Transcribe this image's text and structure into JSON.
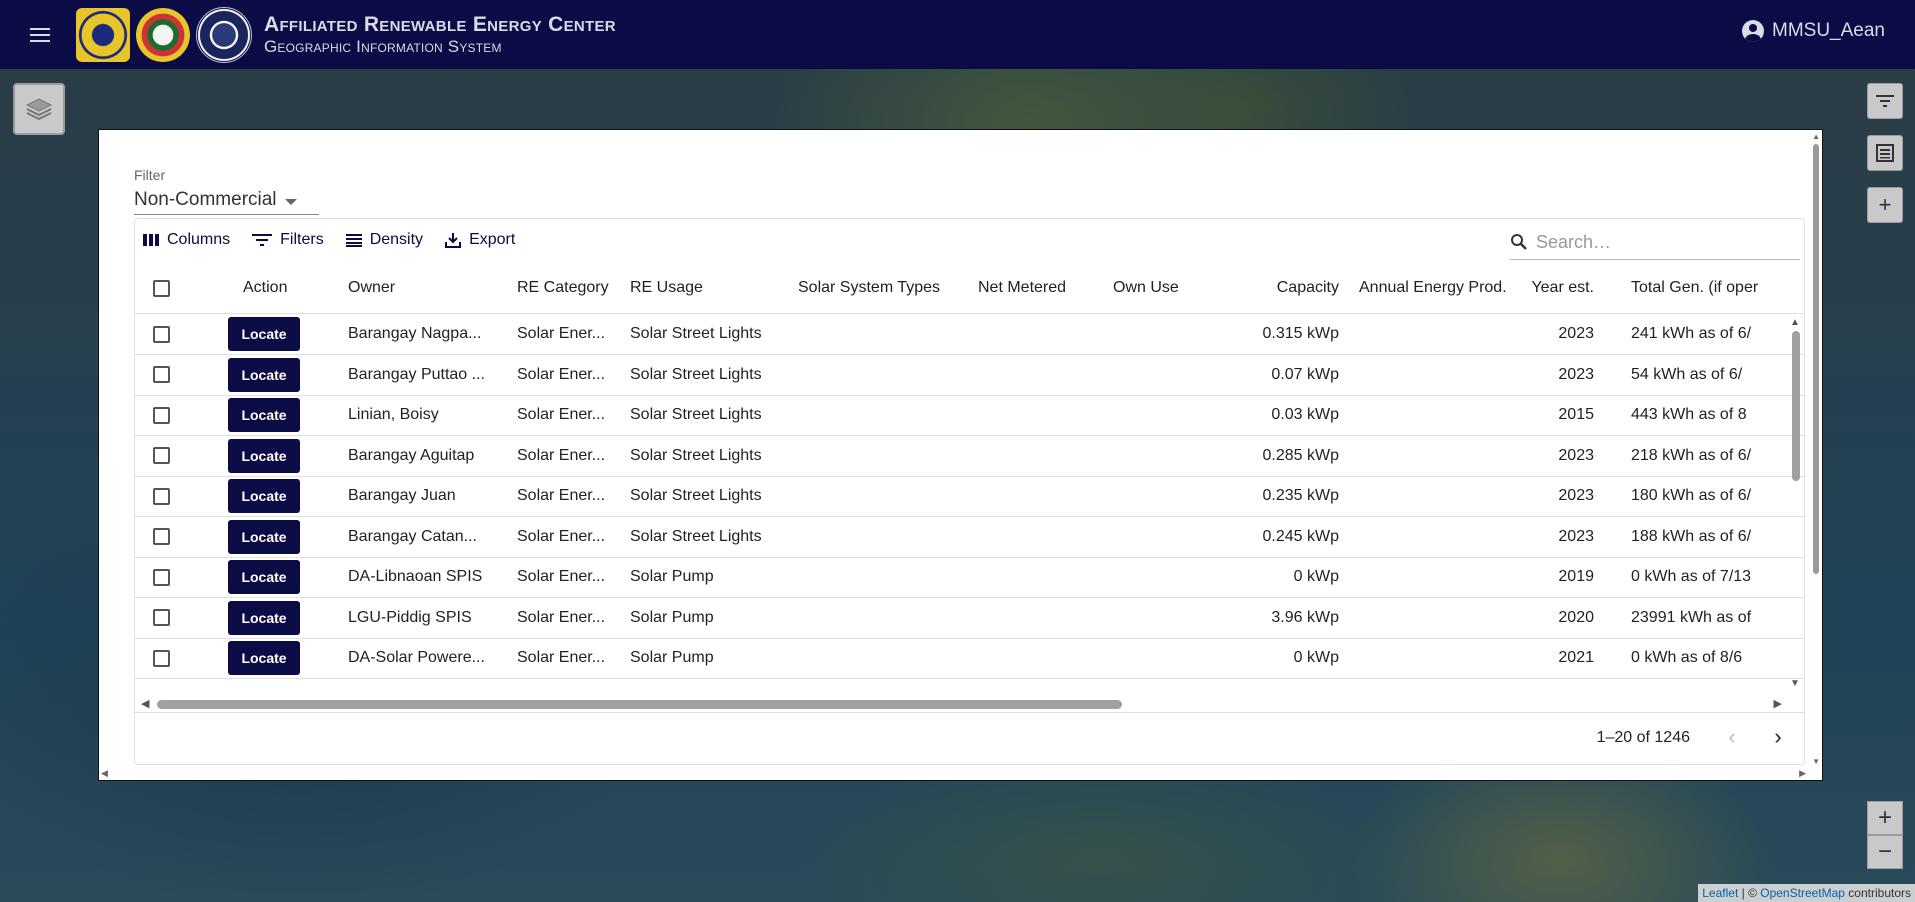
{
  "header": {
    "title": "Affiliated Renewable Energy Center",
    "subtitle": "Geographic Information System",
    "username": "MMSU_Aean",
    "logos": [
      "logo-1",
      "logo-2",
      "logo-3"
    ]
  },
  "filter": {
    "label": "Filter",
    "value": "Non-Commercial"
  },
  "toolbar": {
    "columns": "Columns",
    "filters": "Filters",
    "density": "Density",
    "export": "Export"
  },
  "search": {
    "placeholder": "Search…"
  },
  "table": {
    "headers": [
      "Action",
      "Owner",
      "RE Category",
      "RE Usage",
      "Solar System Types",
      "Net Metered",
      "Own Use",
      "Capacity",
      "Annual Energy Prod.",
      "Year est.",
      "Total Gen. (if oper"
    ],
    "action_label": "Locate",
    "rows": [
      {
        "owner": "Barangay Nagpa...",
        "category": "Solar Ener...",
        "usage": "Solar Street Lights",
        "capacity": "0.315 kWp",
        "year": "2023",
        "total": "241 kWh as of 6/"
      },
      {
        "owner": "Barangay Puttao ...",
        "category": "Solar Ener...",
        "usage": "Solar Street Lights",
        "capacity": "0.07 kWp",
        "year": "2023",
        "total": "54 kWh as of 6/"
      },
      {
        "owner": "Linian, Boisy",
        "category": "Solar Ener...",
        "usage": "Solar Street Lights",
        "capacity": "0.03 kWp",
        "year": "2015",
        "total": "443 kWh as of 8"
      },
      {
        "owner": "Barangay Aguitap",
        "category": "Solar Ener...",
        "usage": "Solar Street Lights",
        "capacity": "0.285 kWp",
        "year": "2023",
        "total": "218 kWh as of 6/"
      },
      {
        "owner": "Barangay Juan",
        "category": "Solar Ener...",
        "usage": "Solar Street Lights",
        "capacity": "0.235 kWp",
        "year": "2023",
        "total": "180 kWh as of 6/"
      },
      {
        "owner": "Barangay Catan...",
        "category": "Solar Ener...",
        "usage": "Solar Street Lights",
        "capacity": "0.245 kWp",
        "year": "2023",
        "total": "188 kWh as of 6/"
      },
      {
        "owner": "DA-Libnaoan SPIS",
        "category": "Solar Ener...",
        "usage": "Solar Pump",
        "capacity": "0 kWp",
        "year": "2019",
        "total": "0 kWh as of 7/13"
      },
      {
        "owner": "LGU-Piddig SPIS",
        "category": "Solar Ener...",
        "usage": "Solar Pump",
        "capacity": "3.96 kWp",
        "year": "2020",
        "total": "23991 kWh as of"
      },
      {
        "owner": "DA-Solar Powere...",
        "category": "Solar Ener...",
        "usage": "Solar Pump",
        "capacity": "0 kWp",
        "year": "2021",
        "total": "0 kWh as of 8/6"
      }
    ]
  },
  "pagination": {
    "text": "1–20 of 1246"
  },
  "map": {
    "attribution_leaflet": "Leaflet",
    "attribution_sep": " | © ",
    "attribution_osm": "OpenStreetMap",
    "attribution_tail": " contributors",
    "zoom_in": "+",
    "zoom_out": "−"
  },
  "colors": {
    "header_bg": "#0b0c45",
    "accent": "#0b0c45"
  }
}
